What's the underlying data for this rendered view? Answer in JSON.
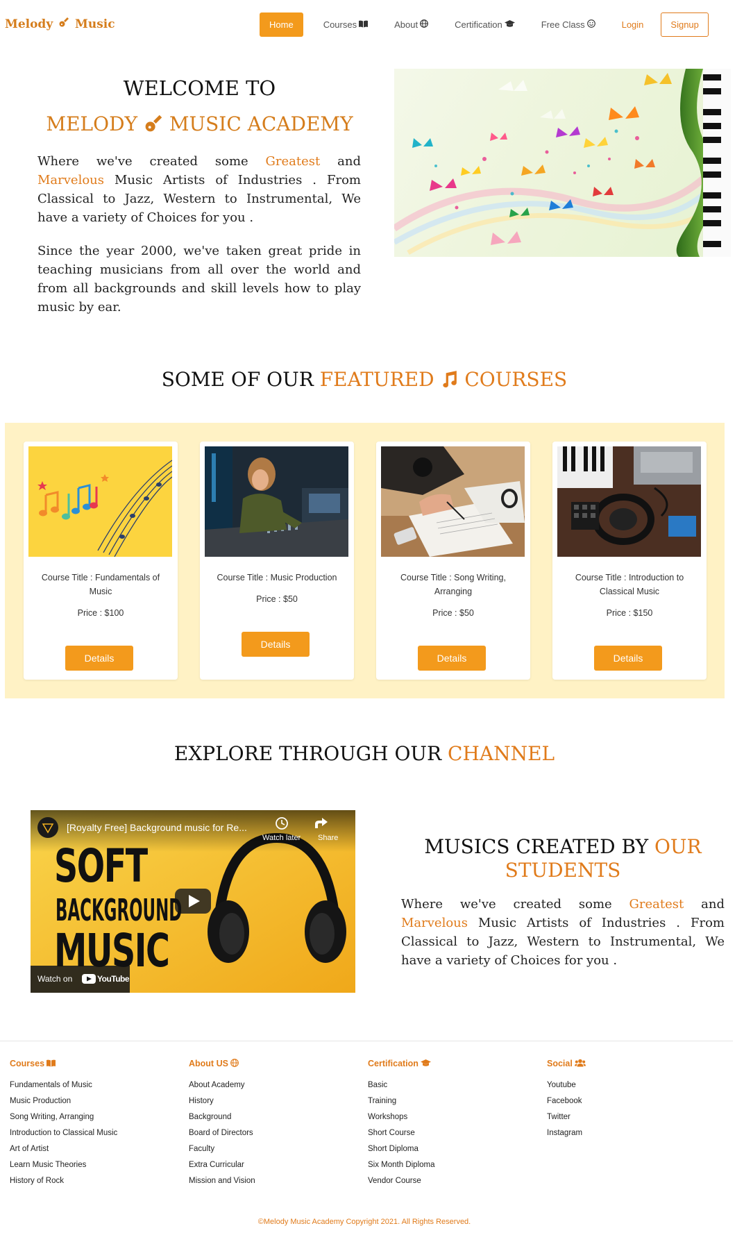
{
  "brand": {
    "name_left": "Melody",
    "name_right": "Music",
    "logo_icon": "guitar-icon"
  },
  "nav": {
    "home": "Home",
    "courses": "Courses",
    "about": "About",
    "certification": "Certification",
    "free_class": "Free Class",
    "login": "Login",
    "signup": "Signup"
  },
  "hero": {
    "welcome": "WELCOME TO",
    "academy_left": "MELODY",
    "academy_right": "MUSIC ACADEMY",
    "p1_a": "Where we've created some",
    "p1_greatest": "Greatest",
    "p1_and": "and",
    "p1_marvelous": "Marvelous",
    "p1_b": "Music Artists of Industries . From Classical to Jazz, Western to Instrumental, We have a variety of Choices for you .",
    "p2": "Since the year 2000, we've taken great pride in teaching musicians from all over the world and from all backgrounds and skill levels how to play music by ear."
  },
  "featured": {
    "title_a": "SOME OF OUR",
    "title_b": "FEATURED",
    "title_c": "COURSES",
    "courses": [
      {
        "title": "Course Title : Fundamentals of Music",
        "price": "Price : $100",
        "button": "Details"
      },
      {
        "title": "Course Title : Music Production",
        "price": "Price : $50",
        "button": "Details"
      },
      {
        "title": "Course Title : Song Writing, Arranging",
        "price": "Price : $50",
        "button": "Details"
      },
      {
        "title": "Course Title : Introduction to Classical Music",
        "price": "Price : $150",
        "button": "Details"
      }
    ]
  },
  "channel": {
    "title_a": "EXPLORE THROUGH OUR",
    "title_b": "CHANNEL",
    "video": {
      "title": "[Royalty Free] Background music for Re...",
      "watch_later": "Watch later",
      "share": "Share",
      "thumb_line1": "SOFT",
      "thumb_line2": "BACKGROUND",
      "thumb_line3": "MUSIC",
      "watch_on": "Watch on",
      "youtube": "YouTube"
    }
  },
  "students": {
    "title_a": "MUSICS CREATED BY",
    "title_b": "OUR STUDENTS",
    "p_a": "Where we've created some",
    "p_greatest": "Greatest",
    "p_and": "and",
    "p_marvelous": "Marvelous",
    "p_b": "Music Artists of Industries . From Classical to Jazz, Western to Instrumental, We have a variety of Choices for you ."
  },
  "footer": {
    "columns": [
      {
        "heading": "Courses",
        "icon": "book-open-icon",
        "links": [
          "Fundamentals of Music",
          "Music Production",
          "Song Writing, Arranging",
          "Introduction to Classical Music",
          "Art of Artist",
          "Learn Music Theories",
          "History of Rock"
        ]
      },
      {
        "heading": "About US",
        "icon": "globe-icon",
        "links": [
          "About Academy",
          "History",
          "Background",
          "Board of Directors",
          "Faculty",
          "Extra Curricular",
          "Mission and Vision"
        ]
      },
      {
        "heading": "Certification",
        "icon": "graduation-cap-icon",
        "links": [
          "Basic",
          "Training",
          "Workshops",
          "Short Course",
          "Short Diploma",
          "Six Month Diploma",
          "Vendor Course"
        ]
      },
      {
        "heading": "Social",
        "icon": "users-icon",
        "links": [
          "Youtube",
          "Facebook",
          "Twitter",
          "Instagram"
        ]
      }
    ],
    "copyright": "©Melody Music Academy Copyright 2021. All Rights Reserved."
  },
  "colors": {
    "accent": "#e07b1b",
    "button": "#f39a1c",
    "band": "#fff2c5"
  }
}
